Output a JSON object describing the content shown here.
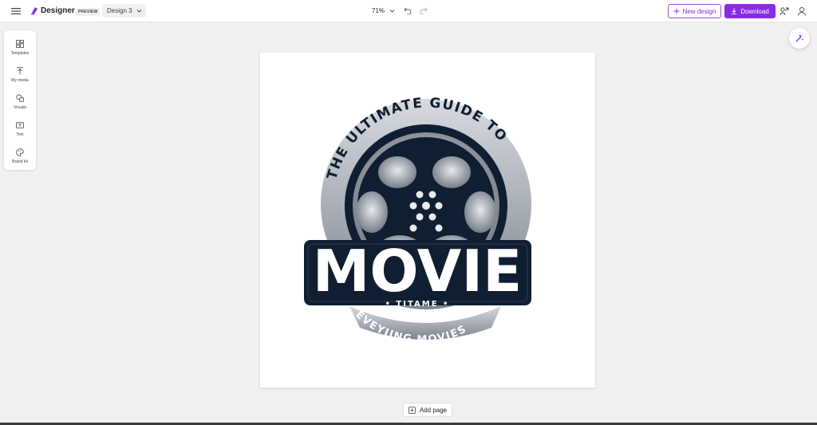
{
  "header": {
    "brand_name": "Designer",
    "preview_badge": "PREVIEW",
    "design_name": "Design 3",
    "zoom_level": "71%",
    "new_design_label": "New design",
    "download_label": "Download"
  },
  "sidebar": {
    "items": [
      {
        "label": "Templates",
        "icon": "templates-icon"
      },
      {
        "label": "My media",
        "icon": "upload-icon"
      },
      {
        "label": "Visuals",
        "icon": "shapes-icon"
      },
      {
        "label": "Text",
        "icon": "text-icon"
      },
      {
        "label": "Brand kit",
        "icon": "palette-icon"
      }
    ]
  },
  "canvas": {
    "logo_arc_top": "THE ULTIMATE GUIDE TO",
    "logo_title": "MOVIE",
    "logo_subtitle": "• TITAME •",
    "logo_arc_bottom": "EVEYIING MOVIES"
  },
  "footer": {
    "add_page_label": "Add page"
  },
  "colors": {
    "accent": "#8a2be2",
    "accent_text": "#7f2fc6",
    "navy": "#0f1e30",
    "silver": "#a9afb7"
  }
}
